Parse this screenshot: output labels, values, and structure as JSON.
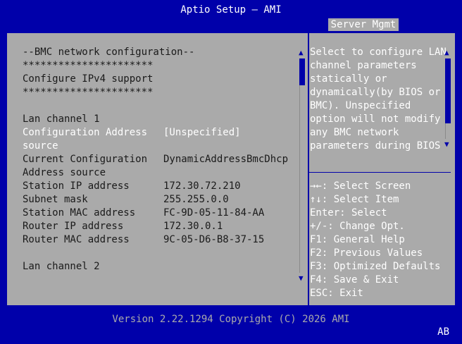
{
  "window": {
    "title": "Aptio Setup – AMI"
  },
  "tabs": [
    {
      "label": "Server Mgmt",
      "active": true
    }
  ],
  "settings": {
    "lines": [
      "--BMC network configuration--",
      "**********************",
      "Configure IPv4 support",
      "**********************",
      "",
      "Lan channel 1"
    ],
    "rows": [
      {
        "label1": "Configuration Address",
        "label2": "source",
        "value": "[Unspecified]",
        "selected": true
      },
      {
        "label1": "Current Configuration",
        "label2": "Address source",
        "value": "DynamicAddressBmcDhcp"
      },
      {
        "label1": "Station IP address",
        "value": "172.30.72.210"
      },
      {
        "label1": "Subnet mask",
        "value": "255.255.0.0"
      },
      {
        "label1": "Station MAC address",
        "value": "FC-9D-05-11-84-AA"
      },
      {
        "label1": "Router IP address",
        "value": "172.30.0.1"
      },
      {
        "label1": "Router MAC address",
        "value": "9C-05-D6-B8-37-15"
      }
    ],
    "lan2": "Lan channel 2"
  },
  "help": {
    "lines": [
      "Select to configure LAN",
      "channel parameters",
      "statically or",
      "dynamically(by BIOS or",
      "BMC). Unspecified",
      "option will not modify",
      "any BMC network",
      "parameters during BIOS"
    ]
  },
  "keys": [
    "→←: Select Screen",
    "↑↓: Select Item",
    "Enter: Select",
    "+/-: Change Opt.",
    "F1: General Help",
    "F2: Previous Values",
    "F3: Optimized Defaults",
    "F4: Save & Exit",
    "ESC: Exit"
  ],
  "footer": {
    "version": "Version 2.22.1294 Copyright (C) 2026 AMI",
    "ime": "AB"
  },
  "colors": {
    "background": "#0000aa",
    "panel": "#aaaaaa",
    "text": "#1a1a1a",
    "highlight": "#ffffff"
  },
  "icons": {
    "scroll_up": "triangle-up-icon",
    "scroll_down": "triangle-down-icon"
  }
}
